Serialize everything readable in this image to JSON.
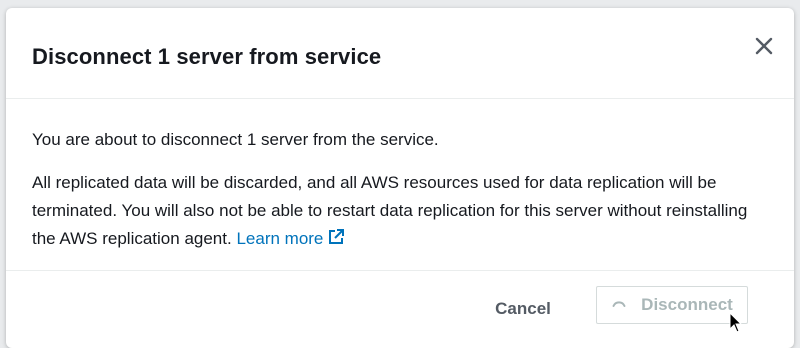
{
  "modal": {
    "title": "Disconnect 1 server from service",
    "close_icon": "close-icon",
    "body": {
      "paragraph1": "You are about to disconnect 1 server from the service.",
      "paragraph2": "All replicated data will be discarded, and all AWS resources used for data replication will be terminated. You will also not be able to restart data replication for this server without reinstalling the AWS replication agent.",
      "learn_more_label": "Learn more",
      "learn_more_icon": "external-link-icon"
    },
    "footer": {
      "cancel_label": "Cancel",
      "disconnect_label": "Disconnect",
      "disconnect_state": "loading",
      "spinner_icon": "spinner-icon"
    }
  },
  "colors": {
    "link": "#0073bb",
    "title_text": "#16191f",
    "cancel_text": "#545b64",
    "disabled_text": "#aab7b8",
    "backdrop": "#e9ebed"
  },
  "cursor_icon": "mouse-pointer-icon"
}
